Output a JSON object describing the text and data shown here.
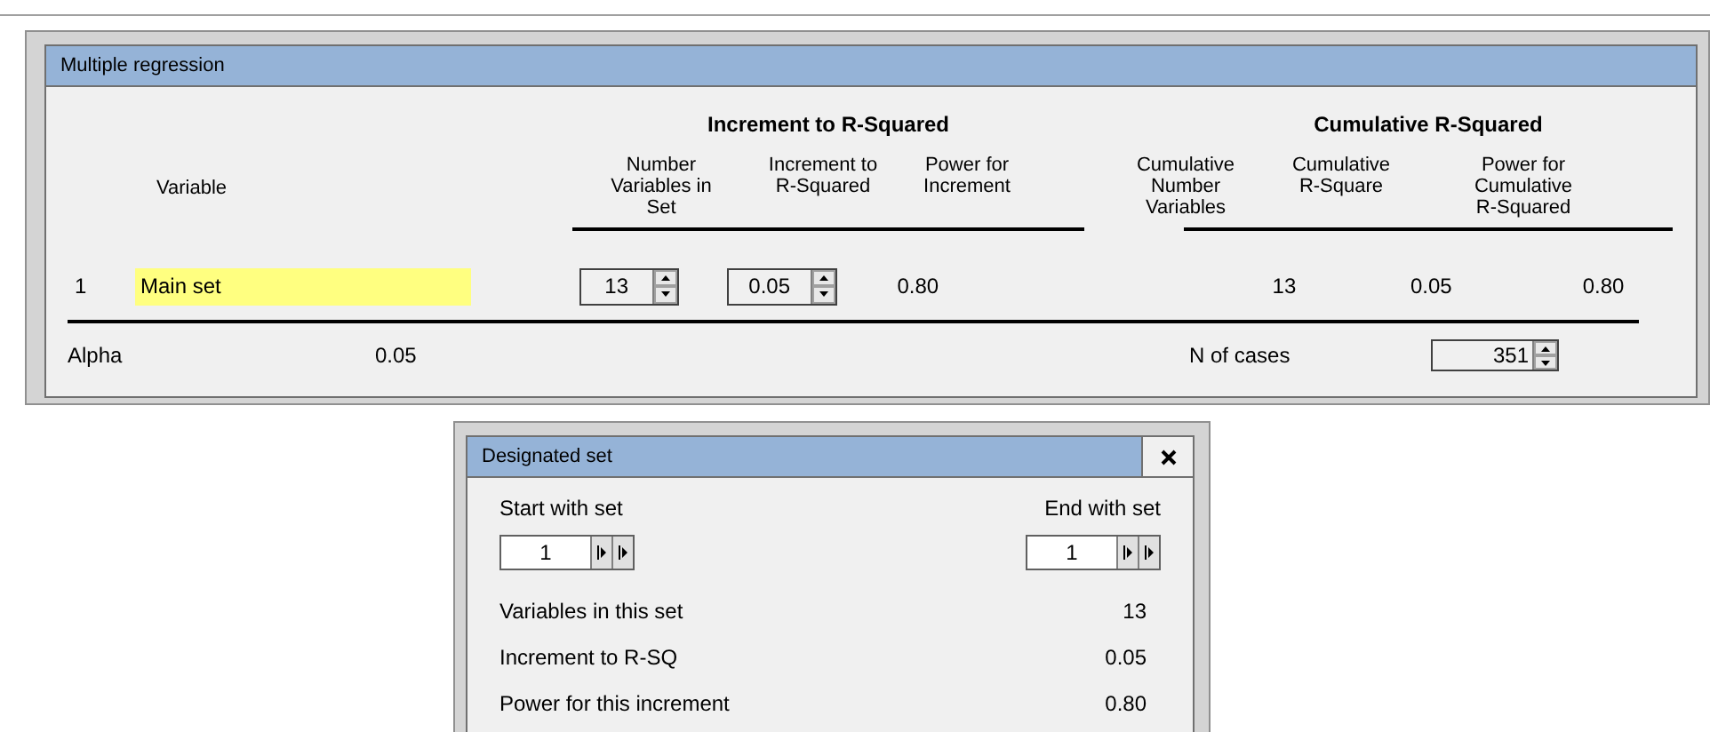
{
  "main_window": {
    "title": "Multiple regression",
    "group_headers": [
      "Increment to R-Squared",
      "Cumulative R-Squared"
    ],
    "columns": [
      "Variable",
      "Number\nVariables in\nSet",
      "Increment to\nR-Squared",
      "Power for\nIncrement",
      "Cumulative\nNumber\nVariables",
      "Cumulative\nR-Square",
      "Power for\nCumulative\nR-Squared"
    ],
    "rows": [
      {
        "index": "1",
        "variable": "Main set",
        "number_variables": "13",
        "increment": "0.05",
        "power_increment": "0.80",
        "cumulative_number": "13",
        "cumulative_r_square": "0.05",
        "power_cumulative": "0.80"
      }
    ],
    "alpha": {
      "label": "Alpha",
      "value": "0.05"
    },
    "n_of_cases": {
      "label": "N of cases",
      "value": "351"
    }
  },
  "dialog": {
    "title": "Designated set",
    "start": {
      "label": "Start with set",
      "value": "1"
    },
    "end": {
      "label": "End with set",
      "value": "1"
    },
    "stats": [
      {
        "label": "Variables in this set",
        "value": "13"
      },
      {
        "label": "Increment to R-SQ",
        "value": "0.05"
      },
      {
        "label": "Power for this increment",
        "value": "0.80"
      }
    ]
  }
}
